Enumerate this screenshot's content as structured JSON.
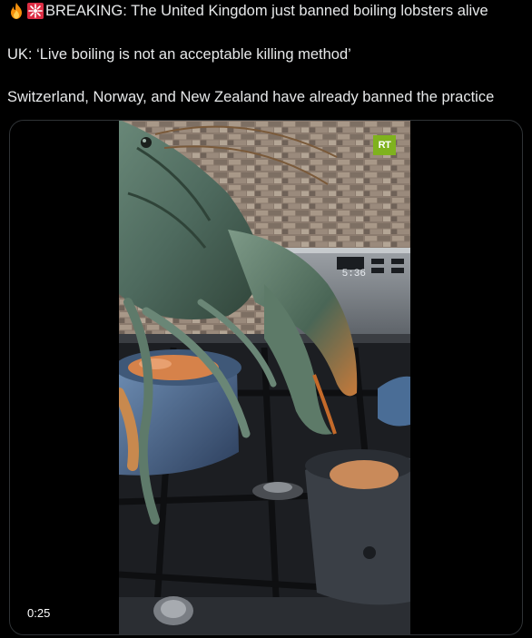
{
  "tweet": {
    "line1_icons": [
      "fire-emoji",
      "rotating-light-emoji"
    ],
    "line1_text": "BREAKING: The United Kingdom just banned boiling lobsters alive",
    "line2_text": "UK: ‘Live boiling is not an acceptable killing method’",
    "line3_text": "Switzerland, Norway, and New Zealand have already banned the practice"
  },
  "video": {
    "channel_logo": "RT",
    "stove_clock": "5:36",
    "duration": "0:25"
  },
  "colors": {
    "background": "#000000",
    "text": "#e7e9ea",
    "rt_green": "#7fb21e",
    "media_border": "#2f3336"
  }
}
